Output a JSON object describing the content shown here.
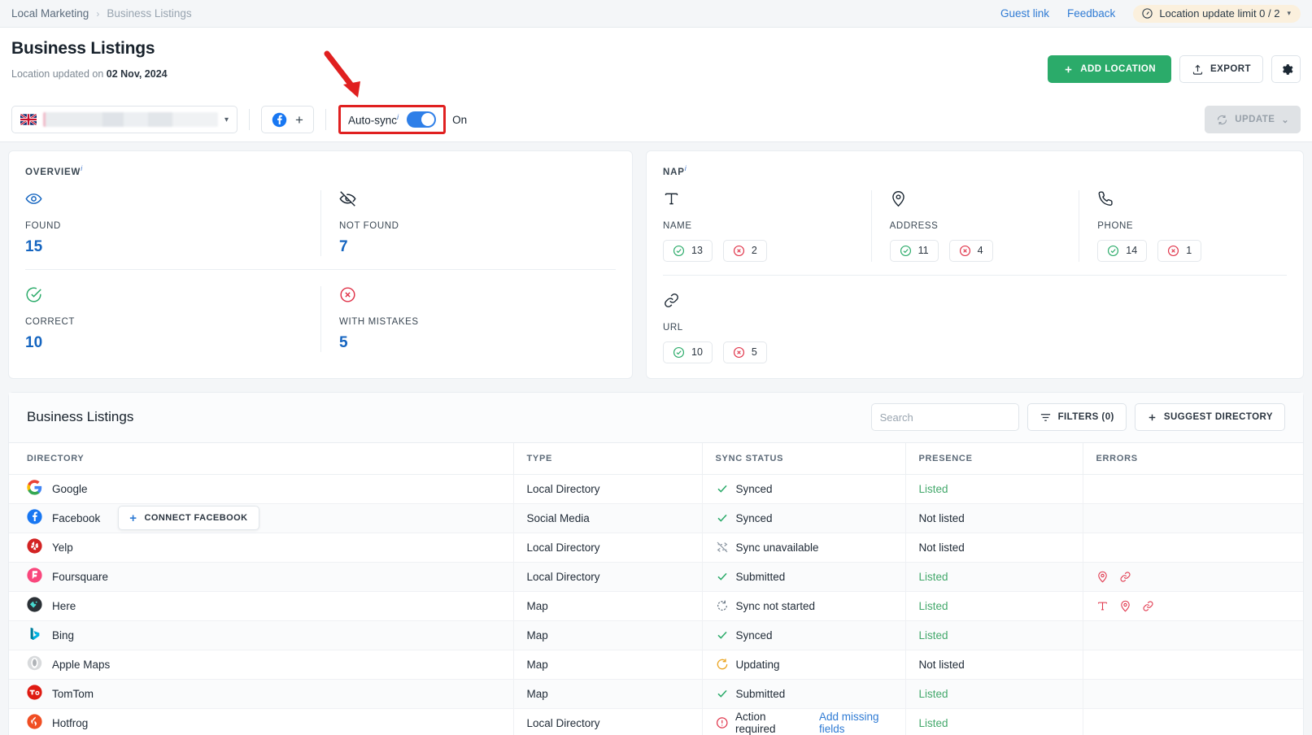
{
  "breadcrumb": {
    "parent": "Local Marketing",
    "separator": "›",
    "current": "Business Listings",
    "guest_link": "Guest link",
    "feedback": "Feedback",
    "limit_badge": "Location update limit  0 / 2",
    "limit_caret": "▾"
  },
  "header": {
    "title": "Business Listings",
    "updated_prefix": "Location updated on",
    "updated_date": "02 Nov, 2024",
    "add_location": "ADD LOCATION",
    "export": "EXPORT"
  },
  "toolbar": {
    "location_value": "",
    "facebook_plus": "+",
    "autosync_label": "Auto-sync",
    "autosync_info": "i",
    "autosync_state": "On",
    "update": "UPDATE",
    "update_caret": "⌄"
  },
  "overview": {
    "title": "OVERVIEW",
    "info": "i",
    "stats": [
      {
        "label": "FOUND",
        "value": "15",
        "icon": "eye-icon"
      },
      {
        "label": "NOT FOUND",
        "value": "7",
        "icon": "eye-off-icon"
      },
      {
        "label": "CORRECT",
        "value": "10",
        "icon": "check-circle-icon"
      },
      {
        "label": "WITH MISTAKES",
        "value": "5",
        "icon": "x-circle-icon"
      }
    ]
  },
  "nap": {
    "title": "NAP",
    "info": "i",
    "fields": [
      {
        "label": "NAME",
        "icon": "text-icon",
        "ok": "13",
        "err": "2"
      },
      {
        "label": "ADDRESS",
        "icon": "map-pin-icon",
        "ok": "11",
        "err": "4"
      },
      {
        "label": "PHONE",
        "icon": "phone-icon",
        "ok": "14",
        "err": "1"
      },
      {
        "label": "URL",
        "icon": "link-icon",
        "ok": "10",
        "err": "5"
      }
    ]
  },
  "listings": {
    "title": "Business Listings",
    "search_placeholder": "Search",
    "search_value": "",
    "filters": "FILTERS (0)",
    "suggest": "SUGGEST DIRECTORY",
    "columns": [
      "DIRECTORY",
      "TYPE",
      "SYNC STATUS",
      "PRESENCE",
      "ERRORS"
    ],
    "rows": [
      {
        "directory": "Google",
        "logo": "google-logo",
        "type": "Local Directory",
        "sync": "Synced",
        "sync_icon": "check",
        "presence": "Listed",
        "presence_state": "listed",
        "errors": []
      },
      {
        "directory": "Facebook",
        "logo": "facebook-logo",
        "type": "Social Media",
        "sync": "Synced",
        "sync_icon": "check",
        "presence": "Not listed",
        "presence_state": "not",
        "errors": [],
        "action": "CONNECT FACEBOOK"
      },
      {
        "directory": "Yelp",
        "logo": "yelp-logo",
        "type": "Local Directory",
        "sync": "Sync unavailable",
        "sync_icon": "unavailable",
        "presence": "Not listed",
        "presence_state": "not",
        "errors": []
      },
      {
        "directory": "Foursquare",
        "logo": "foursquare-logo",
        "type": "Local Directory",
        "sync": "Submitted",
        "sync_icon": "check",
        "presence": "Listed",
        "presence_state": "listed",
        "errors": [
          "map-pin-icon",
          "link-icon"
        ]
      },
      {
        "directory": "Here",
        "logo": "here-logo",
        "type": "Map",
        "sync": "Sync not started",
        "sync_icon": "notstarted",
        "presence": "Listed",
        "presence_state": "listed",
        "errors": [
          "text-icon",
          "map-pin-icon",
          "link-icon"
        ]
      },
      {
        "directory": "Bing",
        "logo": "bing-logo",
        "type": "Map",
        "sync": "Synced",
        "sync_icon": "check",
        "presence": "Listed",
        "presence_state": "listed",
        "errors": []
      },
      {
        "directory": "Apple Maps",
        "logo": "applemaps-logo",
        "type": "Map",
        "sync": "Updating",
        "sync_icon": "updating",
        "presence": "Not listed",
        "presence_state": "not",
        "errors": []
      },
      {
        "directory": "TomTom",
        "logo": "tomtom-logo",
        "type": "Map",
        "sync": "Submitted",
        "sync_icon": "check",
        "presence": "Listed",
        "presence_state": "listed",
        "errors": []
      },
      {
        "directory": "Hotfrog",
        "logo": "hotfrog-logo",
        "type": "Local Directory",
        "sync": "Action required",
        "sync_icon": "alert",
        "sync_link": "Add missing fields",
        "presence": "Listed",
        "presence_state": "listed",
        "errors": []
      }
    ]
  },
  "colors": {
    "accent_green": "#2bab6a",
    "link_blue": "#2f7bd4",
    "stat_blue": "#1565c0",
    "error_red": "#e0344a",
    "ok_green": "#2bab6a",
    "warn_amber": "#eba522",
    "annotation_red": "#e02020",
    "badge_bg": "#fbf0dd"
  }
}
